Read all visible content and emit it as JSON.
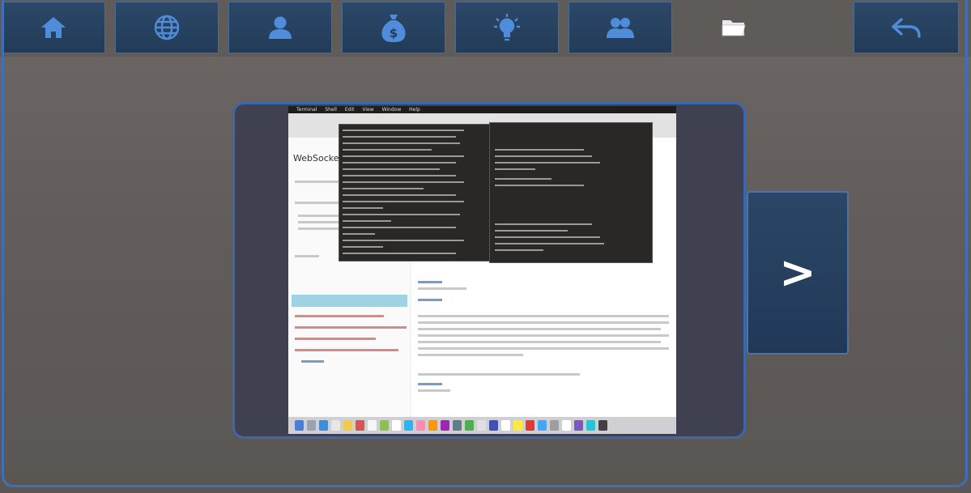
{
  "nav": {
    "items": [
      {
        "id": "home",
        "icon": "home-icon"
      },
      {
        "id": "globe",
        "icon": "globe-icon"
      },
      {
        "id": "user",
        "icon": "user-icon"
      },
      {
        "id": "money",
        "icon": "money-bag-icon"
      },
      {
        "id": "idea",
        "icon": "lightbulb-icon"
      },
      {
        "id": "group",
        "icon": "group-icon"
      },
      {
        "id": "folder",
        "icon": "folder-icon"
      },
      {
        "id": "back",
        "icon": "back-arrow-icon"
      }
    ]
  },
  "colors": {
    "accent": "#3f6fb8",
    "button_bg": "#263f5e",
    "icon": "#4f8ddb",
    "background": "#625d5b"
  },
  "preview": {
    "menubar_items": [
      "Terminal",
      "Shell",
      "Edit",
      "View",
      "Window",
      "Help"
    ],
    "site_title": "WebSocket"
  },
  "next_button": {
    "label": ">"
  }
}
